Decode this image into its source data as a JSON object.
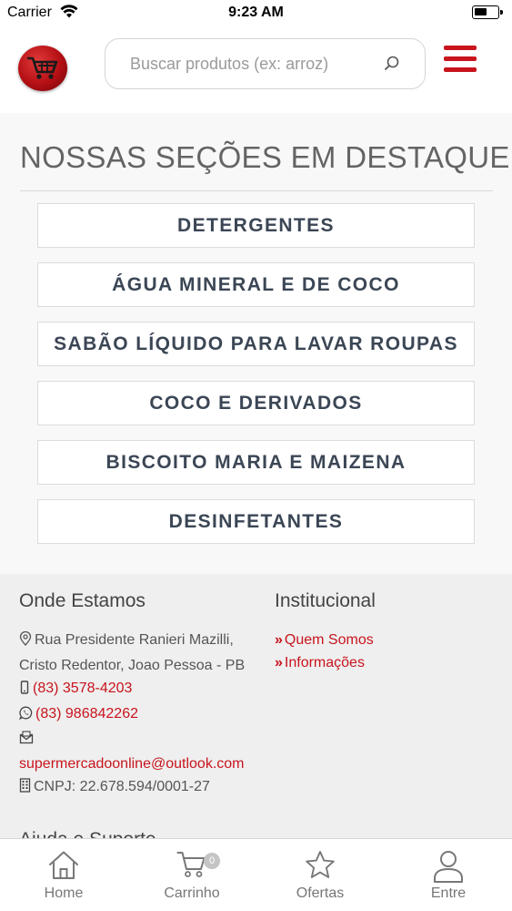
{
  "status_bar": {
    "carrier": "Carrier",
    "time": "9:23 AM"
  },
  "header": {
    "logo_icon": "shopping-cart-logo",
    "search": {
      "placeholder": "Buscar produtos (ex: arroz)",
      "value": ""
    },
    "menu_icon": "hamburger-menu-icon"
  },
  "main": {
    "section_title": "NOSSAS SEÇÕES EM DESTAQUE",
    "categories": [
      {
        "label": "DETERGENTES"
      },
      {
        "label": "ÁGUA MINERAL E DE COCO"
      },
      {
        "label": "SABÃO LÍQUIDO PARA LAVAR ROUPAS"
      },
      {
        "label": "COCO E DERIVADOS"
      },
      {
        "label": "BISCOITO MARIA E MAIZENA"
      },
      {
        "label": "DESINFETANTES"
      }
    ]
  },
  "footer": {
    "location": {
      "heading": "Onde Estamos",
      "address_line1": "Rua Presidente Ranieri Mazilli,",
      "address_line2": "Cristo Redentor, Joao Pessoa - PB",
      "phone": "(83) 3578-4203",
      "whatsapp": "(83) 986842262",
      "email": "supermercadoonline@outlook.com",
      "cnpj": "CNPJ: 22.678.594/0001-27"
    },
    "institutional": {
      "heading": "Institucional",
      "links": [
        {
          "label": "Quem Somos"
        },
        {
          "label": "Informações"
        }
      ]
    },
    "next_heading_partial": "Ajuda e Suporte"
  },
  "tab_bar": {
    "tabs": [
      {
        "label": "Home",
        "icon": "home-icon"
      },
      {
        "label": "Carrinho",
        "icon": "cart-icon",
        "badge": "0"
      },
      {
        "label": "Ofertas",
        "icon": "star-icon"
      },
      {
        "label": "Entre",
        "icon": "user-icon"
      }
    ]
  },
  "colors": {
    "accent": "#c8141d",
    "text_dark": "#3b4655",
    "footer_bg": "#efefef"
  }
}
